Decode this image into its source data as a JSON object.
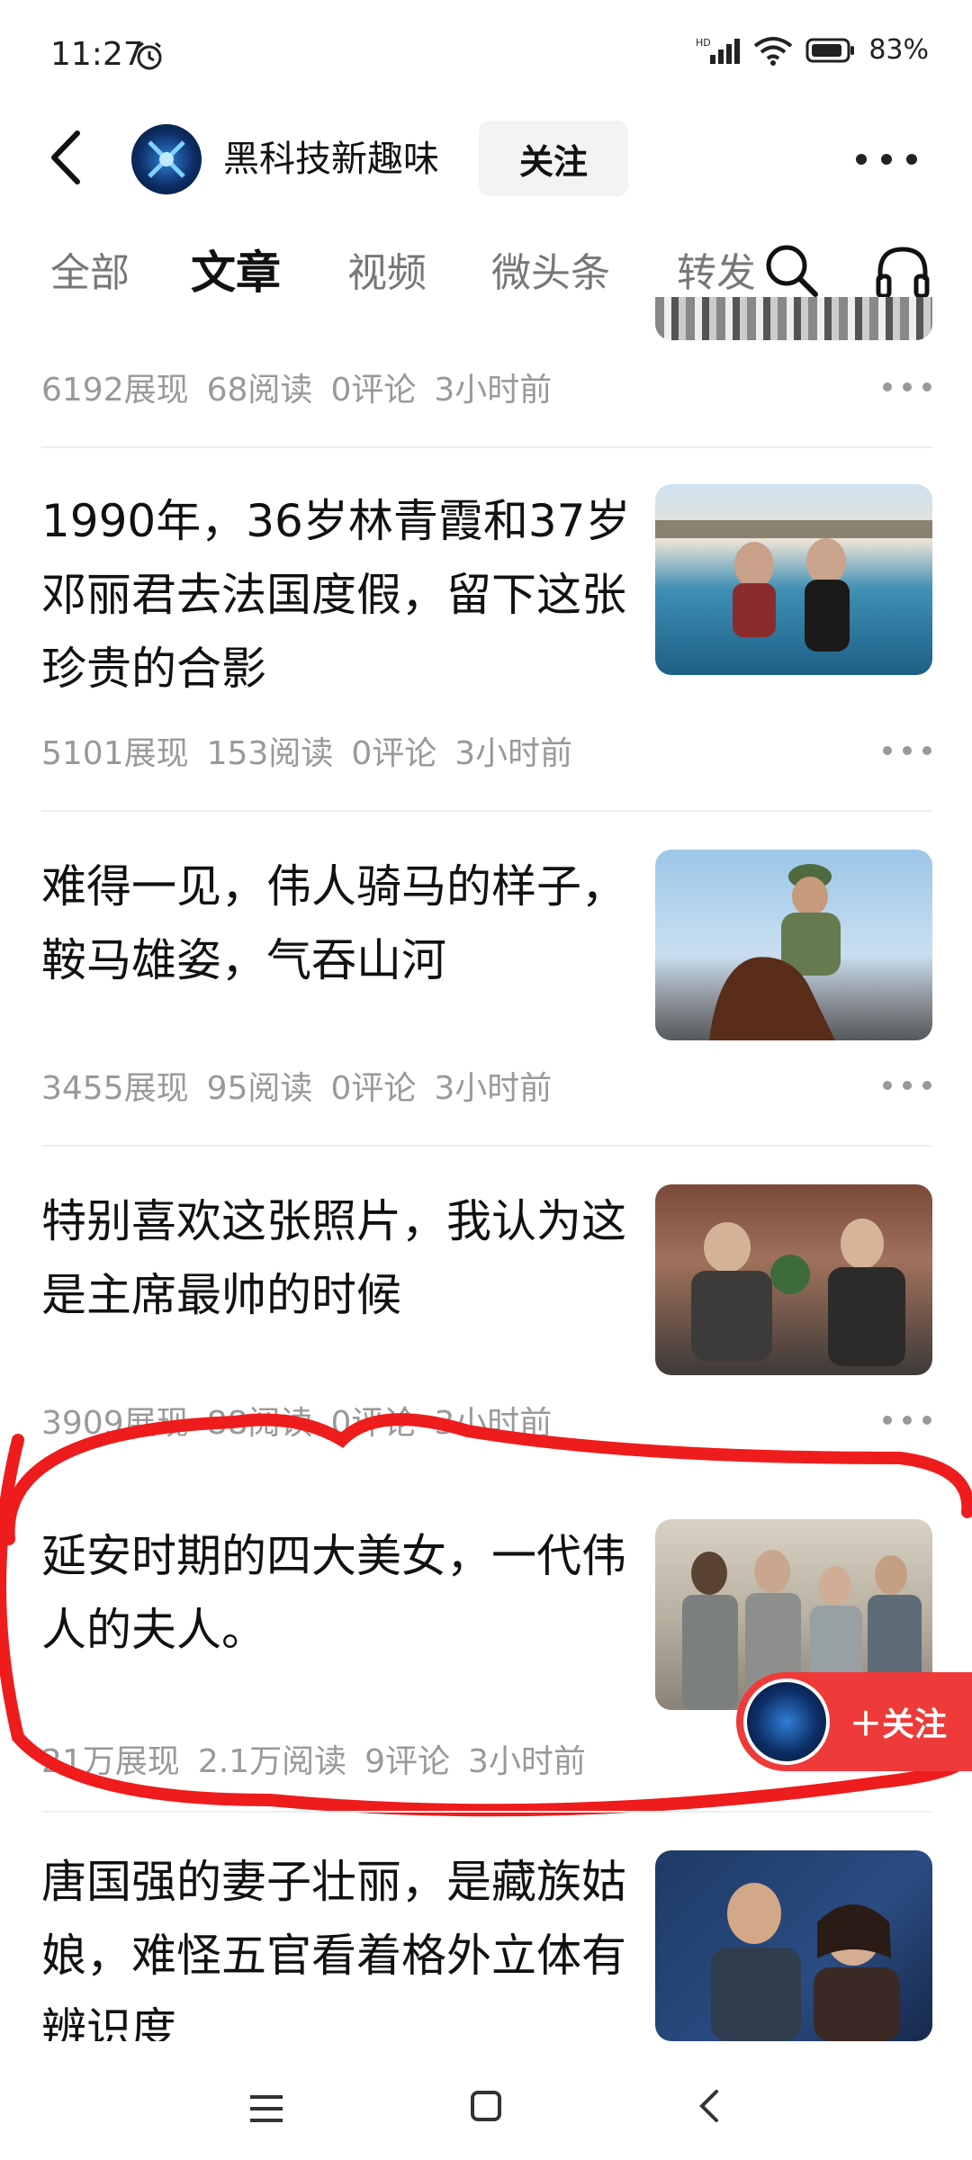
{
  "status_bar": {
    "time": "11:27",
    "signal_label": "HD",
    "battery": "83%"
  },
  "header": {
    "channel_name": "黑科技新趣味",
    "follow_label": "关注"
  },
  "tabs": [
    {
      "label": "全部",
      "active": false
    },
    {
      "label": "文章",
      "active": true
    },
    {
      "label": "视频",
      "active": false
    },
    {
      "label": "微头条",
      "active": false
    },
    {
      "label": "转发",
      "active": false
    }
  ],
  "articles": [
    {
      "title": "",
      "stats": {
        "views": "6192展现",
        "reads": "68阅读",
        "comments": "0评论",
        "time": "3小时前"
      }
    },
    {
      "title": "1990年，36岁林青霞和37岁邓丽君去法国度假，留下这张珍贵的合影",
      "stats": {
        "views": "5101展现",
        "reads": "153阅读",
        "comments": "0评论",
        "time": "3小时前"
      }
    },
    {
      "title": "难得一见，伟人骑马的样子，鞍马雄姿，气吞山河",
      "stats": {
        "views": "3455展现",
        "reads": "95阅读",
        "comments": "0评论",
        "time": "3小时前"
      }
    },
    {
      "title": "特别喜欢这张照片，我认为这是主席最帅的时候",
      "stats": {
        "views": "3909展现",
        "reads": "88阅读",
        "comments": "0评论",
        "time": "3小时前"
      }
    },
    {
      "title": "延安时期的四大美女，一代伟人的夫人。",
      "stats": {
        "views": "21万展现",
        "reads": "2.1万阅读",
        "comments": "9评论",
        "time": "3小时前"
      }
    },
    {
      "title": "唐国强的妻子壮丽，是藏族姑娘，难怪五官看着格外立体有辨识度",
      "stats": {
        "views": "",
        "reads": "",
        "comments": "",
        "time": ""
      }
    }
  ],
  "float_follow": {
    "label": "＋关注"
  },
  "colors": {
    "accent_red": "#ef3a3a",
    "text_gray": "#999999"
  }
}
